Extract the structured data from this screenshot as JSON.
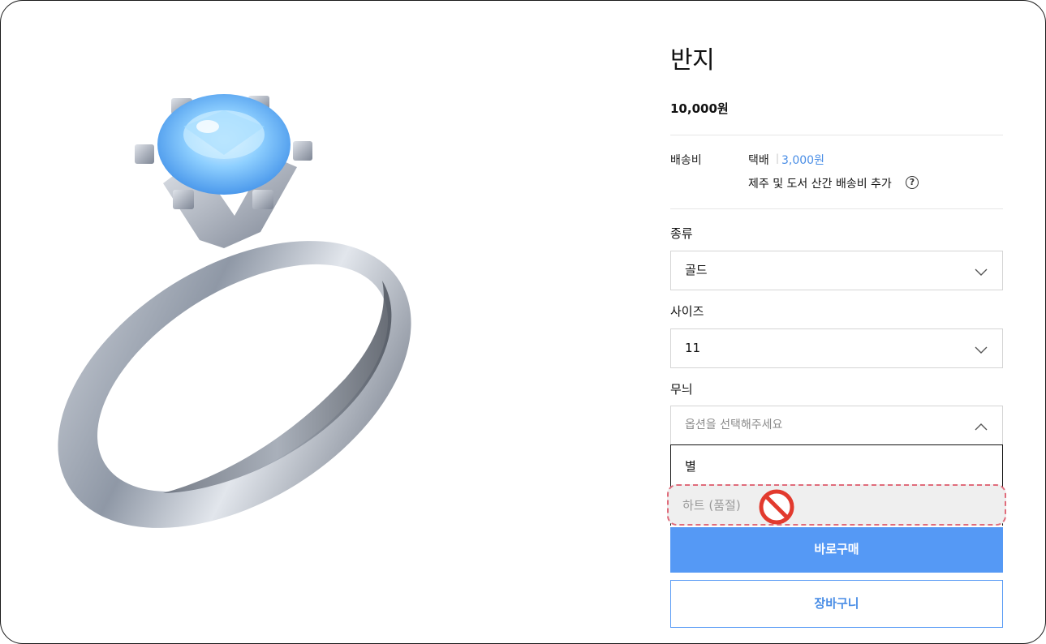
{
  "product": {
    "title": "반지",
    "price": "10,000원"
  },
  "shipping": {
    "label": "배송비",
    "method": "택배",
    "separator": "|",
    "fee": "3,000원",
    "extra_note": "제주 및 도서 산간 배송비 추가",
    "help_icon": "question-circle-icon"
  },
  "options": [
    {
      "label": "종류",
      "value": "골드"
    },
    {
      "label": "사이즈",
      "value": "11"
    },
    {
      "label": "무늬",
      "placeholder": "옵션을 선택해주세요"
    }
  ],
  "dropdown": {
    "items": [
      {
        "label": "별",
        "sold_out": false
      },
      {
        "label": "하트 (품절)",
        "sold_out": true
      }
    ],
    "sold_out_icon": "prohibited-icon"
  },
  "buttons": {
    "buy": "바로구매",
    "cart": "장바구니"
  },
  "colors": {
    "accent": "#5599f5",
    "fee_text": "#4a8ee6",
    "sold_out_highlight": "#e06c7b"
  },
  "image": {
    "icon": "diamond-ring-image"
  }
}
